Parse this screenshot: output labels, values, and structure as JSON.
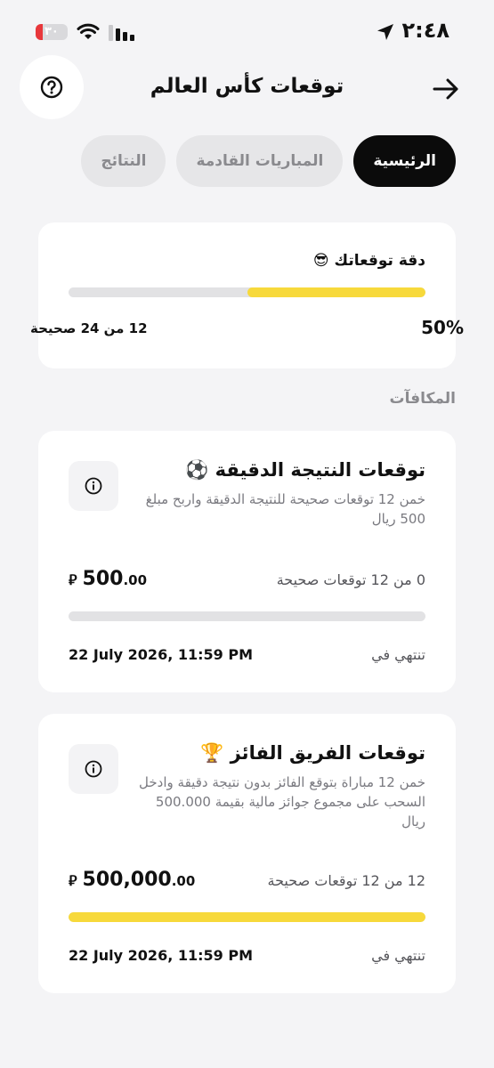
{
  "status": {
    "time": "٢:٤٨",
    "battery": "٣٠"
  },
  "header": {
    "title": "توقعات كأس العالم"
  },
  "tabs": [
    {
      "label": "الرئيسية",
      "active": true
    },
    {
      "label": "المباريات القادمة",
      "active": false
    },
    {
      "label": "النتائج",
      "active": false
    }
  ],
  "accuracy": {
    "title": "دقة توقعاتك 😎",
    "percent_label": "50%",
    "progress": 0.5,
    "count_label": "12 من 24 صحيحة"
  },
  "rewards_section": {
    "title": "المكافآت"
  },
  "rewards": [
    {
      "title": "توقعات النتيجة الدقيقة ⚽",
      "description": "خمن 12 توقعات صحيحة للنتيجة الدقيقة واربح مبلغ 500 ريال",
      "progress_label": "0 من 12 توقعات صحيحة",
      "progress": 0,
      "amount_main": "500",
      "amount_decimals": ".00",
      "currency_symbol": "⃁",
      "ends_label": "تنتهي في",
      "ends_date": "22 July 2026, 11:59 PM"
    },
    {
      "title": "توقعات الفريق الفائز 🏆",
      "description": "خمن 12 مباراة بتوقع الفائز بدون نتيجة دقيقة وادخل السحب على مجموع جوائز مالية بقيمة 500.000 ريال",
      "progress_label": "12 من 12 توقعات صحيحة",
      "progress": 1,
      "amount_main": "500,000",
      "amount_decimals": ".00",
      "currency_symbol": "⃁",
      "ends_label": "تنتهي في",
      "ends_date": "22 July 2026, 11:59 PM"
    }
  ],
  "colors": {
    "accent": "#F7D93B",
    "active_tab": "#0B0B0B",
    "track": "#E2E2E4"
  }
}
